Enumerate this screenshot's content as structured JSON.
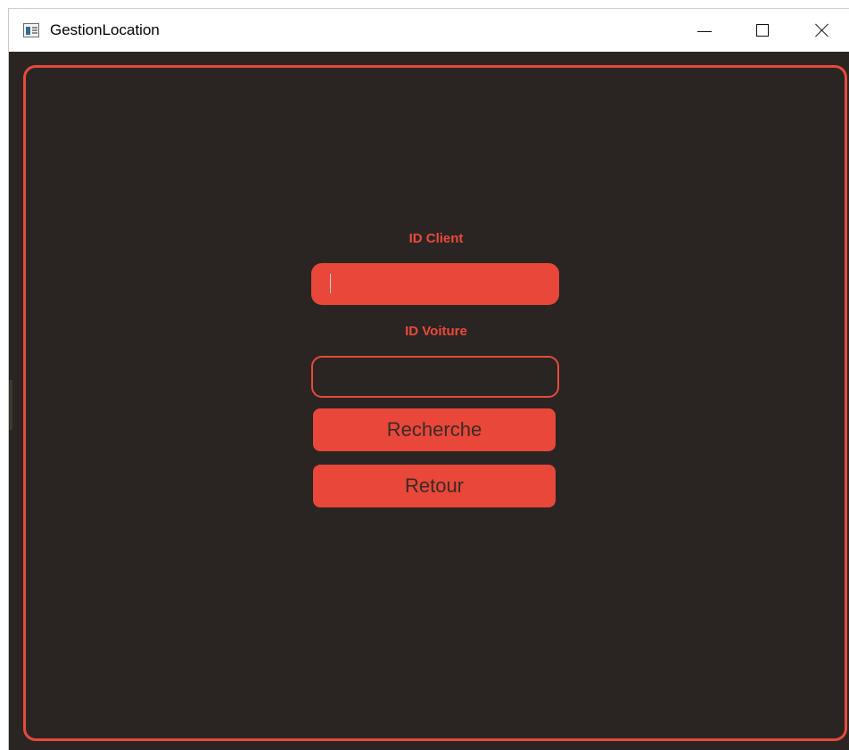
{
  "window": {
    "title": "GestionLocation"
  },
  "form": {
    "id_client_label": "ID Client",
    "id_client_value": "",
    "id_voiture_label": "ID Voiture",
    "id_voiture_value": ""
  },
  "buttons": {
    "search_label": "Recherche",
    "back_label": "Retour"
  },
  "colors": {
    "background": "#2a2523",
    "accent": "#e8473a",
    "button_text": "#3b2b28"
  },
  "icons": {
    "app": "app-window-icon",
    "minimize": "minimize-icon",
    "maximize": "maximize-icon",
    "close": "close-icon"
  }
}
